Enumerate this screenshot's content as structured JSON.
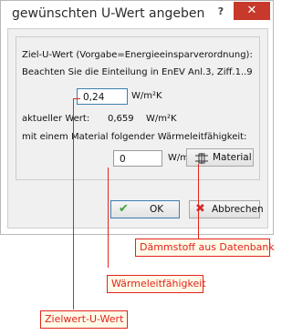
{
  "window": {
    "title": "gewünschten U-Wert angeben",
    "help_label": "?",
    "close_label": "✕"
  },
  "form": {
    "line1": "Ziel-U-Wert (Vorgabe=Energieeinsparverordnung):",
    "line2": "Beachten Sie die Einteilung in EnEV Anl.3, Ziff.1..9",
    "target_value": "0,24",
    "target_unit": "W/m²K",
    "current_label": "aktueller Wert:",
    "current_value": "0,659",
    "current_unit": "W/m²K",
    "material_line": "mit einem Material folgender Wärmeleitfähigkeit:",
    "conductivity_value": "0",
    "conductivity_unit": "W/mK",
    "material_button": "Material"
  },
  "buttons": {
    "ok": "OK",
    "cancel": "Abbrechen"
  },
  "annotations": {
    "insulation": "Dämmstoff aus Datenbank",
    "conductivity": "Wärmeleitfähigkeit",
    "target": "Zielwert-U-Wert"
  },
  "colors": {
    "annotation": "#e3231d",
    "close": "#c7392b",
    "ok_check": "#3aa53a",
    "cancel_x": "#d03030"
  }
}
